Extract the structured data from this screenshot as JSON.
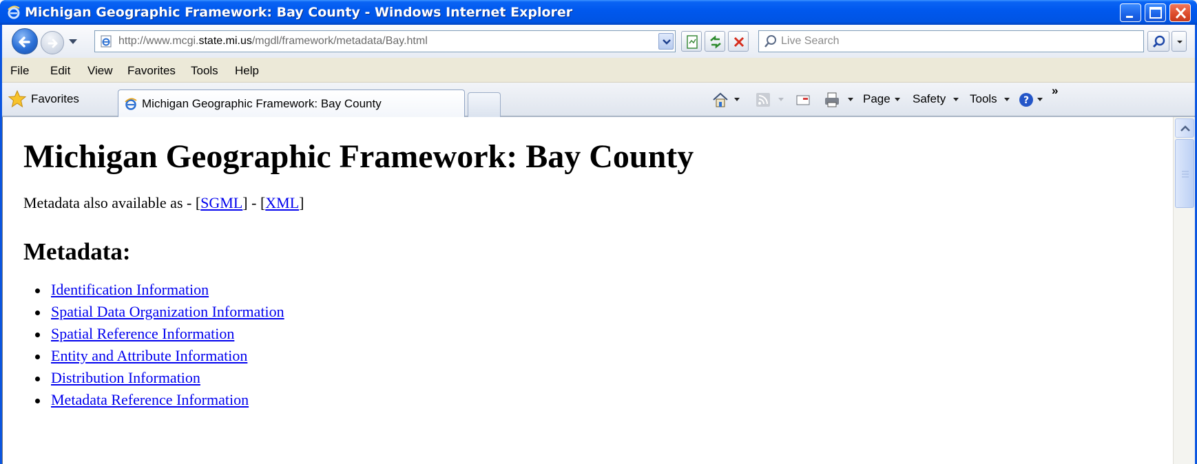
{
  "window": {
    "title": "Michigan Geographic Framework: Bay County - Windows Internet Explorer",
    "controls": {
      "minimize": "minimize",
      "maximize": "maximize",
      "close": "close"
    }
  },
  "navigation": {
    "url_prefix": "http://www.mcgi.",
    "url_host": "state.mi.us",
    "url_path": "/mgdl/framework/metadata/Bay.html",
    "search_placeholder": "Live Search"
  },
  "menu": [
    "File",
    "Edit",
    "View",
    "Favorites",
    "Tools",
    "Help"
  ],
  "favorites_bar": {
    "favorites_label": "Favorites",
    "active_tab": "Michigan Geographic Framework: Bay County"
  },
  "command_bar": {
    "page": "Page",
    "safety": "Safety",
    "tools": "Tools",
    "overflow": "»"
  },
  "page": {
    "heading": "Michigan Geographic Framework: Bay County",
    "also_prefix": "Metadata also available as - [",
    "sgml_link": "SGML",
    "also_middle": "] - [",
    "xml_link": "XML",
    "also_suffix": "]",
    "metadata_heading": "Metadata:",
    "toc": [
      "Identification Information",
      "Spatial Data Organization Information",
      "Spatial Reference Information",
      "Entity and Attribute Information",
      "Distribution Information",
      "Metadata Reference Information"
    ]
  },
  "colors": {
    "titlebar": "#0054e3",
    "link": "#0000ee",
    "chrome": "#ece9d8"
  }
}
